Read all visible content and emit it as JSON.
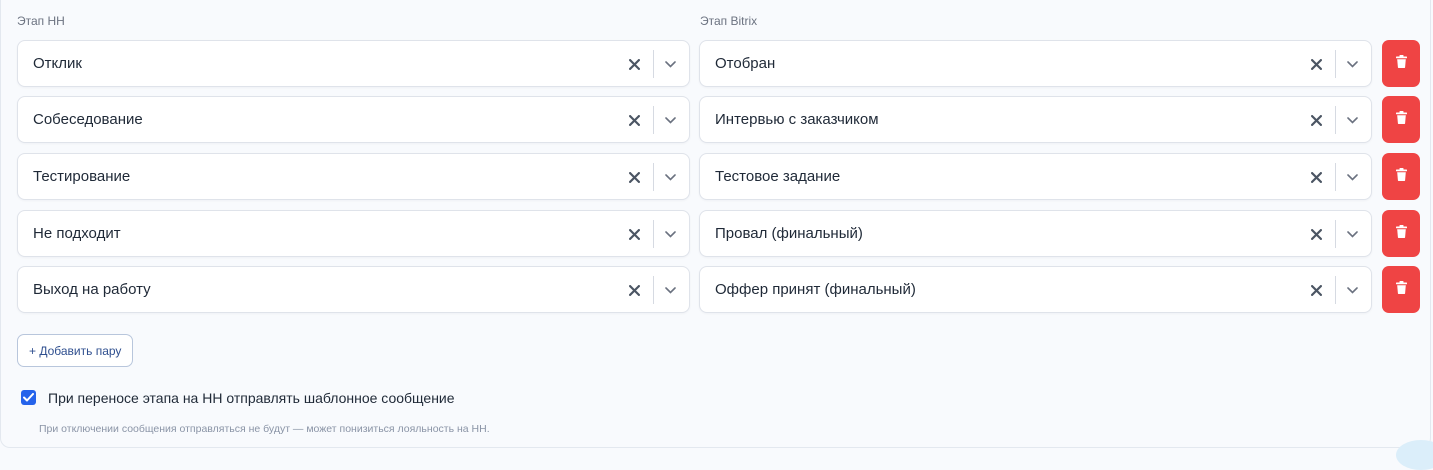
{
  "columns": {
    "hh_label": "Этап HH",
    "bitrix_label": "Этап Bitrix"
  },
  "pairs": [
    {
      "hh": "Отклик",
      "bitrix": "Отобран"
    },
    {
      "hh": "Собеседование",
      "bitrix": "Интервью с заказчиком"
    },
    {
      "hh": "Тестирование",
      "bitrix": "Тестовое задание"
    },
    {
      "hh": "Не подходит",
      "bitrix": "Провал (финальный)"
    },
    {
      "hh": "Выход на работу",
      "bitrix": "Оффер принят (финальный)"
    }
  ],
  "add_pair_label": "+ Добавить пару",
  "send_template": {
    "checked": true,
    "label": "При переносе этапа на HH отправлять шаблонное сообщение",
    "hint": "При отключении сообщения отправляться не будут — может понизиться лояльность на HH."
  },
  "colors": {
    "delete": "#ef4444",
    "checkbox": "#2563eb",
    "add_text": "#2f4f8f"
  },
  "icons": {
    "clear": "x-icon",
    "dropdown": "chevron-down-icon",
    "delete": "trash-icon",
    "checkbox": "check-icon"
  }
}
